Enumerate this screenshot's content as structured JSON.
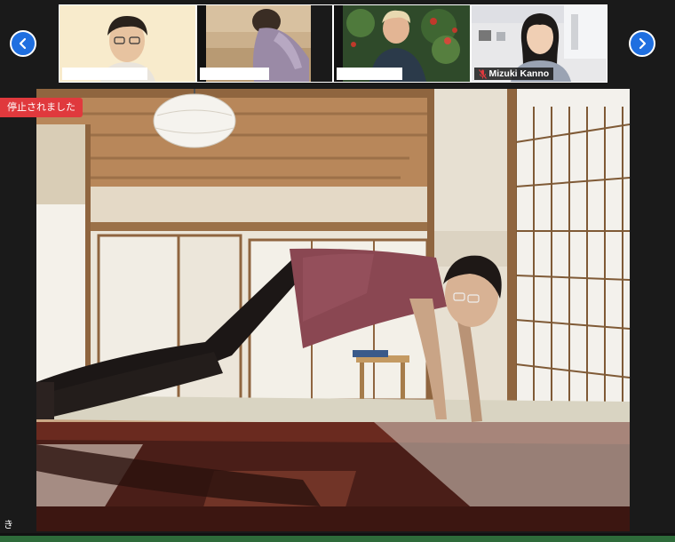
{
  "gallery": {
    "participants": [
      {
        "name": "",
        "muted": false
      },
      {
        "name": "",
        "muted": false
      },
      {
        "name": "",
        "muted": false
      },
      {
        "name": "Mizuki Kanno",
        "muted": true
      }
    ],
    "prev_icon": "chevron-left-icon",
    "next_icon": "chevron-right-icon"
  },
  "main": {
    "status_badge": "停止されました",
    "corner_label": "き"
  },
  "colors": {
    "nav_button": "#1f6fe0",
    "badge": "#e0393d",
    "mute": "#e0393d"
  }
}
